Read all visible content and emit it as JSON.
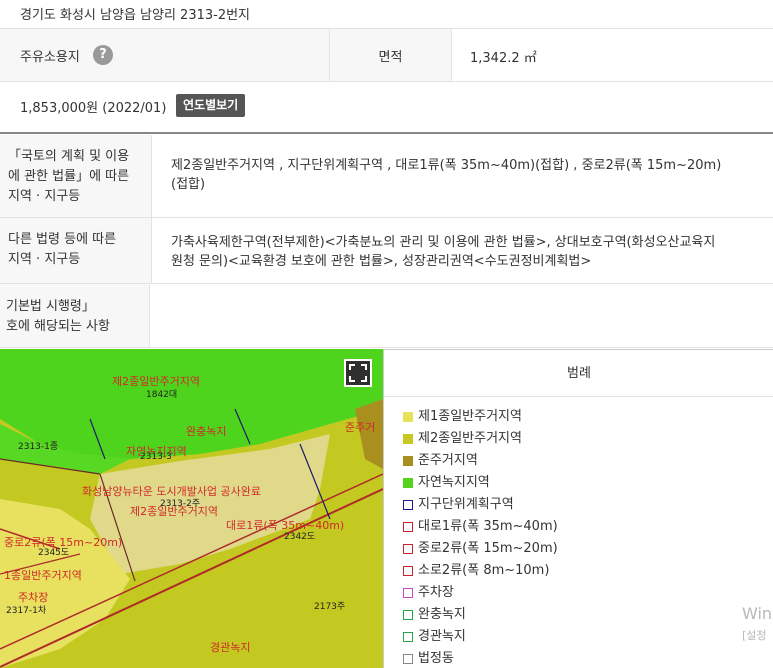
{
  "address": "경기도 화성시 남양읍 남양리 2313-2번지",
  "land_use": {
    "label": "주유소용지",
    "help_icon": "question-icon"
  },
  "area": {
    "label": "면적",
    "value": "1,342.2 ㎡"
  },
  "price": {
    "value": "1,853,000원 (2022/01)",
    "button": "연도별보기"
  },
  "sections": [
    {
      "label_lines": [
        "「국토의 계획 및 이용",
        "에 관한 법률」에 따른",
        "지역 · 지구등"
      ],
      "text_lines": [
        "제2종일반주거지역 , 지구단위계획구역 , 대로1류(폭 35m~40m)(접합) , 중로2류(폭 15m~20m)",
        "(접합)"
      ]
    },
    {
      "label_lines": [
        "다른 법령 등에 따른",
        "지역 · 지구등"
      ],
      "text_lines": [
        "가축사육제한구역(전부제한)<가축분뇨의 관리 및 이용에 관한 법률>, 상대보호구역(화성오산교육지",
        "원청 문의)<교육환경 보호에 관한 법률>, 성장관리권역<수도권정비계획법>"
      ]
    },
    {
      "label_lines": [
        "기본법 시행령」",
        "호에 해당되는 사항"
      ],
      "text_lines": []
    }
  ],
  "map": {
    "fullscreen_icon": "fullscreen-icon",
    "labels": {
      "zone_top": "제2종일반주거지역",
      "lot_1842": "1842대",
      "lot_2313_1": "2313-1종",
      "buffer_green": "완충녹지",
      "natural_green": "자연녹지지역",
      "lot_2313_3": "2313-3",
      "project": "화성남양뉴타운 도시개발사업 공사완료",
      "lot_2313_2": "2313-2주",
      "zone_mid": "제2종일반주거지역",
      "road1": "대로1류(폭 35m~40m)",
      "lot_2342": "2342도",
      "road2": "중로2류(폭 15m~20m)",
      "road3": "소로2류(폭 8m~10m)",
      "lot_2345": "2345도",
      "zone_low": "1종일반주거지역",
      "parking": "주차장",
      "lot_2317": "2317-1차",
      "lot_2173": "2173주",
      "scenic_green": "경관녹지",
      "semi_res": "준주거"
    }
  },
  "legend": {
    "title": "범례",
    "items": [
      {
        "label": "제1종일반주거지역",
        "color": "#e6e35a",
        "style": "fill"
      },
      {
        "label": "제2종일반주거지역",
        "color": "#c9c820",
        "style": "fill"
      },
      {
        "label": "준주거지역",
        "color": "#a88f1e",
        "style": "fill"
      },
      {
        "label": "자연녹지지역",
        "color": "#55d31f",
        "style": "fill"
      },
      {
        "label": "지구단위계획구역",
        "color": "#1c1c9a",
        "style": "outline"
      },
      {
        "label": "대로1류(폭 35m~40m)",
        "color": "#c2272d",
        "style": "outline"
      },
      {
        "label": "중로2류(폭 15m~20m)",
        "color": "#c2272d",
        "style": "outline"
      },
      {
        "label": "소로2류(폭 8m~10m)",
        "color": "#c2272d",
        "style": "outline"
      },
      {
        "label": "주차장",
        "color": "#c84ac8",
        "style": "outline"
      },
      {
        "label": "완충녹지",
        "color": "#2aa64a",
        "style": "outline"
      },
      {
        "label": "경관녹지",
        "color": "#2aa64a",
        "style": "outline"
      },
      {
        "label": "법정동",
        "color": "#888888",
        "style": "outline"
      }
    ]
  },
  "watermark": {
    "line1": "Win",
    "line2": "[설정"
  }
}
